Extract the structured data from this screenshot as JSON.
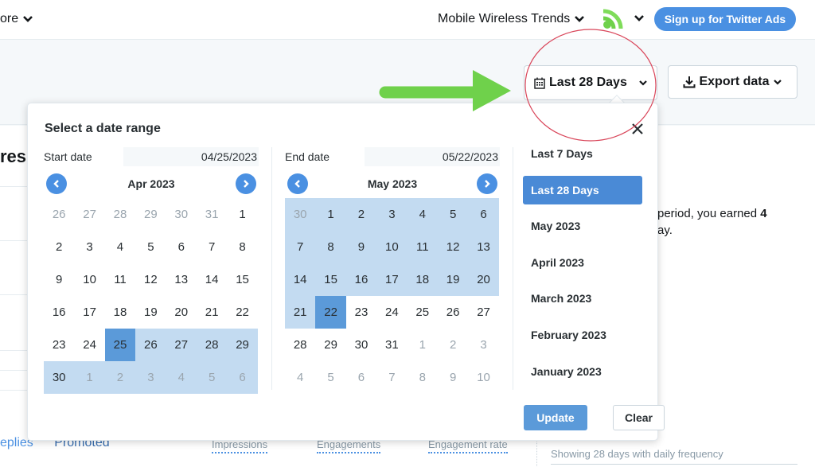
{
  "topbar": {
    "more_label": "ore",
    "account_name": "Mobile Wireless Trends",
    "signup_label": "Sign up for Twitter Ads"
  },
  "toolbar": {
    "date_range_label": "Last 28 Days",
    "export_label": "Export data"
  },
  "background": {
    "title_fragment": "res",
    "earned_line1_prefix": "period, you earned ",
    "earned_line1_value": "4",
    "earned_line2": "ay.",
    "tabs": [
      "eplies",
      "Promoted"
    ],
    "columns": [
      "Impressions",
      "Engagements",
      "Engagement rate"
    ],
    "frequency_text": "Showing 28 days with daily frequency"
  },
  "popup": {
    "title": "Select a date range",
    "start": {
      "label": "Start date",
      "value": "04/25/2023",
      "month": "Apr 2023",
      "days": [
        {
          "d": "26",
          "m": true
        },
        {
          "d": "27",
          "m": true
        },
        {
          "d": "28",
          "m": true
        },
        {
          "d": "29",
          "m": true
        },
        {
          "d": "30",
          "m": true
        },
        {
          "d": "31",
          "m": true
        },
        {
          "d": "1"
        },
        {
          "d": "2"
        },
        {
          "d": "3"
        },
        {
          "d": "4"
        },
        {
          "d": "5"
        },
        {
          "d": "6"
        },
        {
          "d": "7"
        },
        {
          "d": "8"
        },
        {
          "d": "9"
        },
        {
          "d": "10"
        },
        {
          "d": "11"
        },
        {
          "d": "12"
        },
        {
          "d": "13"
        },
        {
          "d": "14"
        },
        {
          "d": "15"
        },
        {
          "d": "16"
        },
        {
          "d": "17"
        },
        {
          "d": "18"
        },
        {
          "d": "19"
        },
        {
          "d": "20"
        },
        {
          "d": "21"
        },
        {
          "d": "22"
        },
        {
          "d": "23"
        },
        {
          "d": "24"
        },
        {
          "d": "25",
          "s": true
        },
        {
          "d": "26",
          "r": true
        },
        {
          "d": "27",
          "r": true
        },
        {
          "d": "28",
          "r": true
        },
        {
          "d": "29",
          "r": true
        },
        {
          "d": "30",
          "r": true
        },
        {
          "d": "1",
          "m": true,
          "r": true
        },
        {
          "d": "2",
          "m": true,
          "r": true
        },
        {
          "d": "3",
          "m": true,
          "r": true
        },
        {
          "d": "4",
          "m": true,
          "r": true
        },
        {
          "d": "5",
          "m": true,
          "r": true
        },
        {
          "d": "6",
          "m": true,
          "r": true
        }
      ]
    },
    "end": {
      "label": "End date",
      "value": "05/22/2023",
      "month": "May 2023",
      "days": [
        {
          "d": "30",
          "m": true,
          "r": true
        },
        {
          "d": "1",
          "r": true
        },
        {
          "d": "2",
          "r": true
        },
        {
          "d": "3",
          "r": true
        },
        {
          "d": "4",
          "r": true
        },
        {
          "d": "5",
          "r": true
        },
        {
          "d": "6",
          "r": true
        },
        {
          "d": "7",
          "r": true
        },
        {
          "d": "8",
          "r": true
        },
        {
          "d": "9",
          "r": true
        },
        {
          "d": "10",
          "r": true
        },
        {
          "d": "11",
          "r": true
        },
        {
          "d": "12",
          "r": true
        },
        {
          "d": "13",
          "r": true
        },
        {
          "d": "14",
          "r": true
        },
        {
          "d": "15",
          "r": true
        },
        {
          "d": "16",
          "r": true
        },
        {
          "d": "17",
          "r": true
        },
        {
          "d": "18",
          "r": true
        },
        {
          "d": "19",
          "r": true
        },
        {
          "d": "20",
          "r": true
        },
        {
          "d": "21",
          "r": true
        },
        {
          "d": "22",
          "s": true
        },
        {
          "d": "23"
        },
        {
          "d": "24"
        },
        {
          "d": "25"
        },
        {
          "d": "26"
        },
        {
          "d": "27"
        },
        {
          "d": "28"
        },
        {
          "d": "29"
        },
        {
          "d": "30"
        },
        {
          "d": "31"
        },
        {
          "d": "1",
          "m": true
        },
        {
          "d": "2",
          "m": true
        },
        {
          "d": "3",
          "m": true
        },
        {
          "d": "4",
          "m": true
        },
        {
          "d": "5",
          "m": true
        },
        {
          "d": "6",
          "m": true
        },
        {
          "d": "7",
          "m": true
        },
        {
          "d": "8",
          "m": true
        },
        {
          "d": "9",
          "m": true
        },
        {
          "d": "10",
          "m": true
        }
      ]
    },
    "presets": [
      {
        "label": "Last 7 Days"
      },
      {
        "label": "Last 28 Days",
        "active": true
      },
      {
        "label": "May 2023"
      },
      {
        "label": "April 2023"
      },
      {
        "label": "March 2023"
      },
      {
        "label": "February 2023"
      },
      {
        "label": "January 2023"
      }
    ],
    "update_label": "Update",
    "clear_label": "Clear"
  },
  "colors": {
    "accent": "#4a90e2",
    "range_fill": "#c3dbf1",
    "selected_fill": "#5b9ad9",
    "annotation_arrow": "#6fd14b",
    "annotation_circle": "#d9465a"
  }
}
